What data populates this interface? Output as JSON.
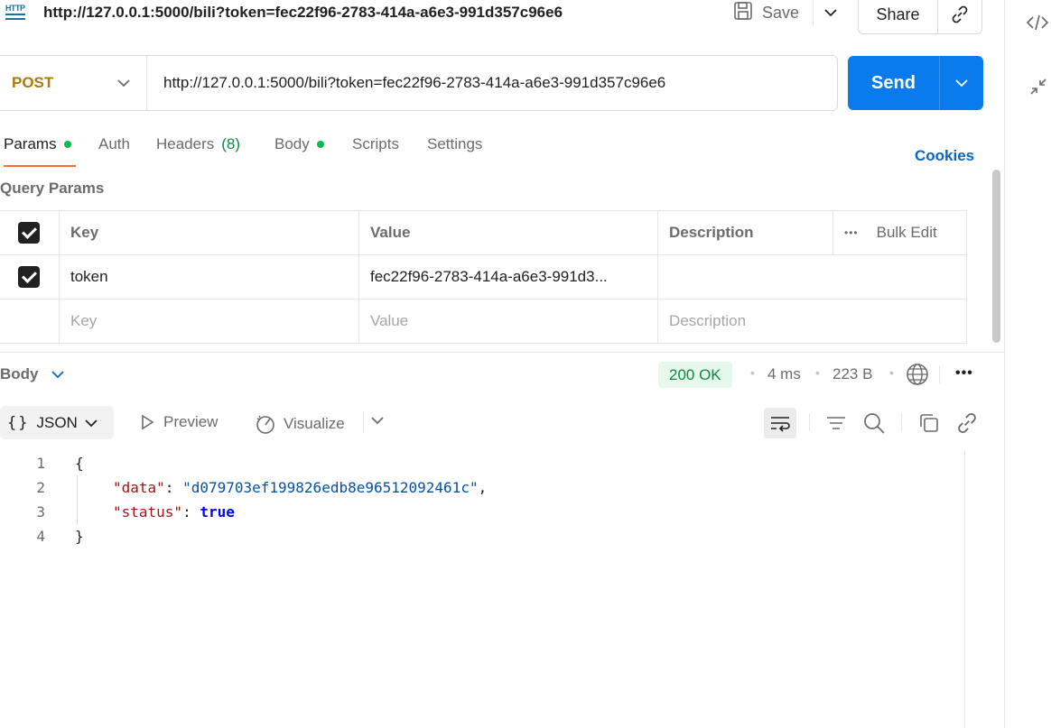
{
  "title_bar": {
    "method_icon_text": "HTTP",
    "url": "http://127.0.0.1:5000/bili?token=fec22f96-2783-414a-a6e3-991d357c96e6",
    "save_label": "Save",
    "share_label": "Share"
  },
  "request": {
    "method": "POST",
    "url": "http://127.0.0.1:5000/bili?token=fec22f96-2783-414a-a6e3-991d357c96e6",
    "send_label": "Send"
  },
  "tabs": {
    "params": "Params",
    "auth": "Auth",
    "headers": "Headers",
    "headers_count": "(8)",
    "body": "Body",
    "scripts": "Scripts",
    "settings": "Settings",
    "cookies": "Cookies"
  },
  "query_params": {
    "title": "Query Params",
    "columns": [
      "Key",
      "Value",
      "Description"
    ],
    "bulk_edit": "Bulk Edit",
    "rows": [
      {
        "key": "token",
        "value": "fec22f96-2783-414a-a6e3-991d3...",
        "description": ""
      }
    ],
    "placeholders": {
      "key": "Key",
      "value": "Value",
      "description": "Description"
    }
  },
  "response": {
    "body_label": "Body",
    "status": "200 OK",
    "time": "4 ms",
    "size": "223 B",
    "format": "JSON",
    "preview_label": "Preview",
    "visualize_label": "Visualize",
    "line_numbers": [
      "1",
      "2",
      "3",
      "4"
    ],
    "open_brace": "{",
    "close_brace": "}",
    "data_key": "\"data\"",
    "data_value": "\"d079703ef199826edb8e96512092461c\"",
    "status_key": "\"status\"",
    "status_value": "true"
  },
  "colors": {
    "send": "#097bed",
    "method": "#ad7a03",
    "status_ok": "#0c8a3e",
    "cookies": "#0b65c2",
    "active_tab": "#ff6c37"
  }
}
